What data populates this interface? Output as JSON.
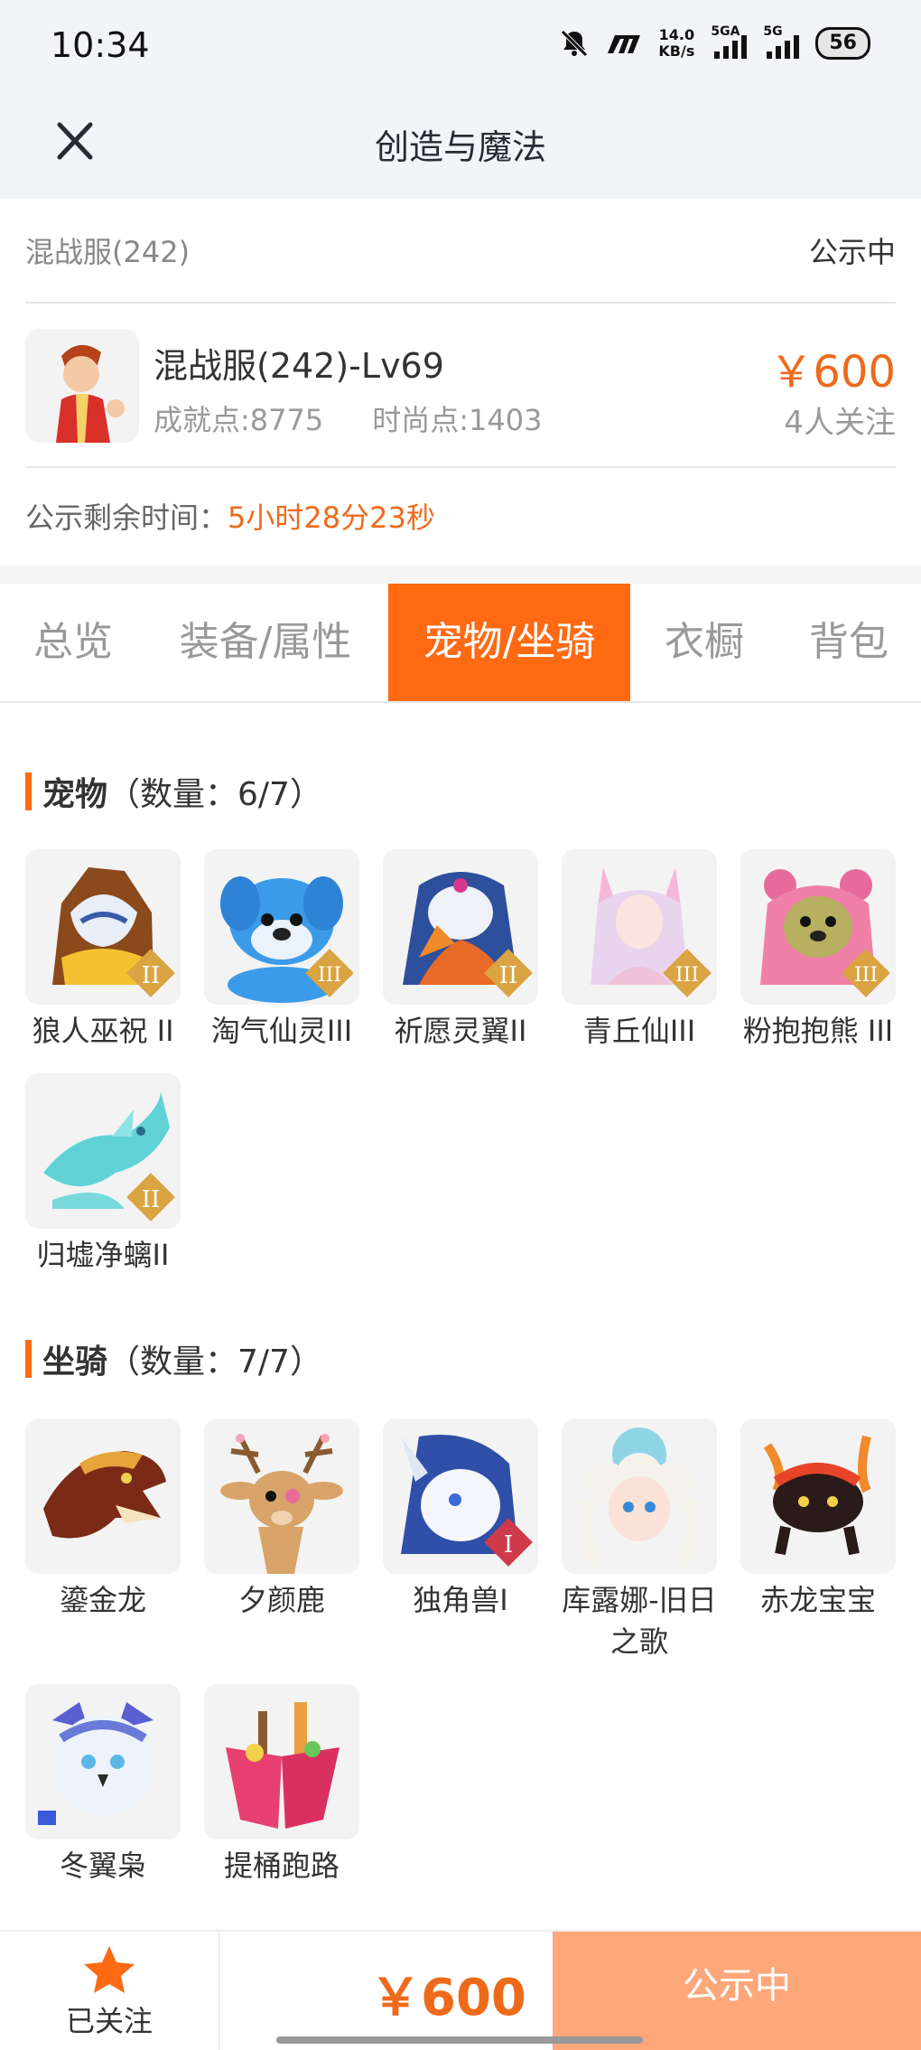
{
  "status_bar": {
    "time": "10:34",
    "net_speed_value": "14.0",
    "net_speed_unit": "KB/s",
    "signal1_label": "5GA",
    "signal2_label": "5G",
    "battery": "56",
    "icons": [
      "mute-icon",
      "carrier-logo-icon"
    ]
  },
  "nav": {
    "title": "创造与魔法",
    "close_icon": "close-icon"
  },
  "server": {
    "name": "混战服(242)",
    "status": "公示中"
  },
  "character": {
    "name": "混战服(242)-Lv69",
    "achievement": "成就点:8775",
    "fashion": "时尚点:1403",
    "price": "￥600",
    "followers": "4人关注"
  },
  "remaining": {
    "label": "公示剩余时间：",
    "value": "5小时28分23秒"
  },
  "tabs": [
    {
      "label": "总览"
    },
    {
      "label": "装备/属性"
    },
    {
      "label": "宠物/坐骑"
    },
    {
      "label": "衣橱"
    },
    {
      "label": "背包"
    }
  ],
  "active_tab": 2,
  "pets": {
    "title": "宠物",
    "count": "（数量：6/7）",
    "items": [
      {
        "name": "狼人巫祝 II",
        "badge": "II"
      },
      {
        "name": "淘气仙灵III",
        "badge": "III"
      },
      {
        "name": "祈愿灵翼II",
        "badge": "II"
      },
      {
        "name": "青丘仙III",
        "badge": "III"
      },
      {
        "name": "粉抱抱熊 III",
        "badge": "III"
      },
      {
        "name": "归墟净螭II",
        "badge": "II"
      }
    ]
  },
  "mounts": {
    "title": "坐骑",
    "count": "（数量：7/7）",
    "items": [
      {
        "name": "鎏金龙"
      },
      {
        "name": "夕颜鹿"
      },
      {
        "name": "独角兽I",
        "badge": "I"
      },
      {
        "name": "库露娜-旧日之歌"
      },
      {
        "name": "赤龙宝宝"
      },
      {
        "name": "冬翼枭"
      },
      {
        "name": "提桶跑路"
      }
    ]
  },
  "bottom": {
    "follow_label": "已关注",
    "follow_icon": "star-icon",
    "price": "￥600",
    "cta": "公示中"
  },
  "colors": {
    "accent": "#ff6a13",
    "price": "#ee6a1b",
    "cta_bg": "#fda77a"
  }
}
